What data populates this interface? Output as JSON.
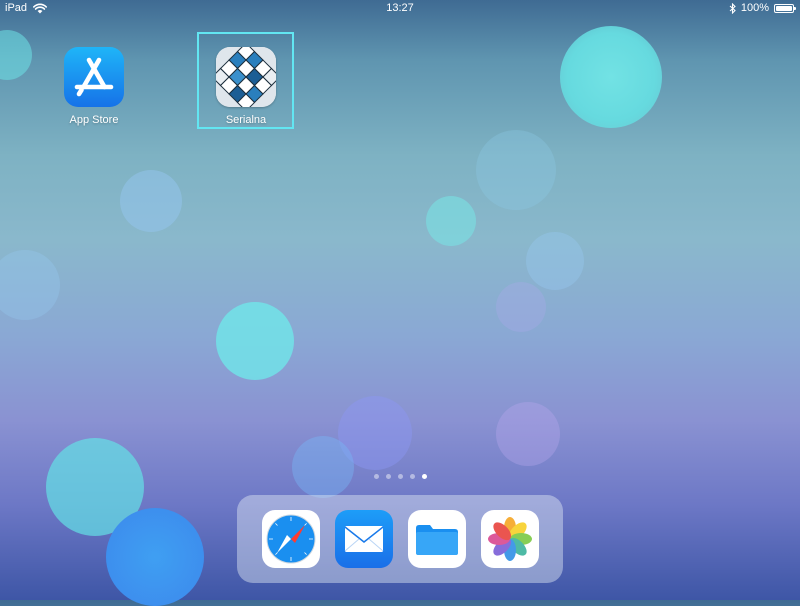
{
  "status_bar": {
    "device": "iPad",
    "time": "13:27",
    "battery": "100%",
    "battery_level": 1.0
  },
  "home_apps": [
    {
      "label": "App Store",
      "icon": "app-store-icon"
    },
    {
      "label": "Serialna",
      "icon": "serialna-app-icon",
      "focused": true
    }
  ],
  "page_indicator": {
    "count": 5,
    "active_index": 4
  },
  "dock": [
    {
      "name": "Safari",
      "icon": "safari-icon"
    },
    {
      "name": "Mail",
      "icon": "mail-icon"
    },
    {
      "name": "Files",
      "icon": "files-icon"
    },
    {
      "name": "Photos",
      "icon": "photos-icon"
    }
  ],
  "colors": {
    "focus_ring": "#62e6f2",
    "app_store": "#1a8cf0",
    "mail": "#1a85f0"
  }
}
